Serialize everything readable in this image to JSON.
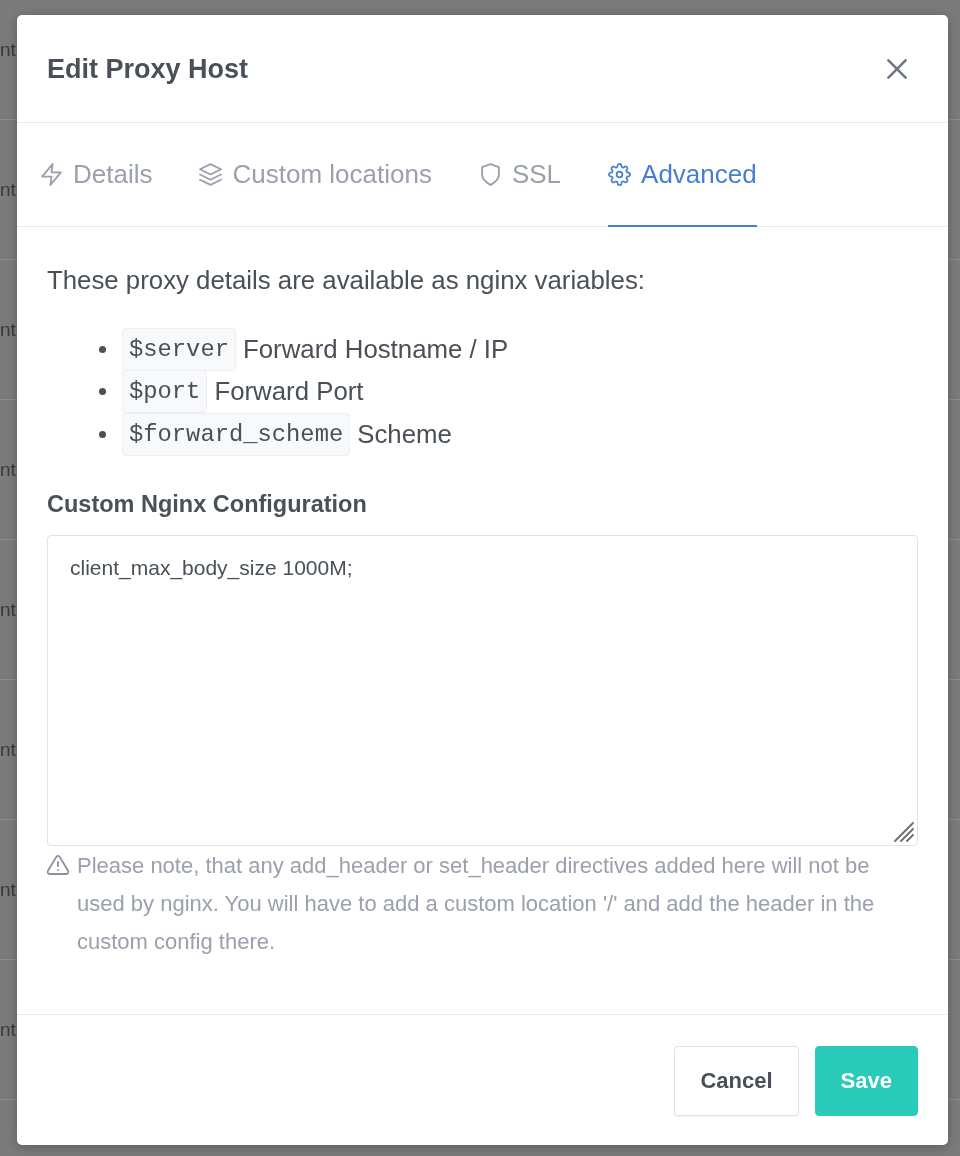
{
  "background_rows": [
    {
      "text": "nt"
    },
    {
      "text": "nt"
    },
    {
      "text": "nt"
    },
    {
      "text": "nt"
    },
    {
      "text": "nt"
    },
    {
      "text": "nt"
    },
    {
      "text": "nt"
    },
    {
      "text": "nt"
    }
  ],
  "dialog": {
    "title": "Edit Proxy Host"
  },
  "tabs": [
    {
      "label": "Details",
      "selected": false
    },
    {
      "label": "Custom locations",
      "selected": false
    },
    {
      "label": "SSL",
      "selected": false
    },
    {
      "label": "Advanced",
      "selected": true
    }
  ],
  "advanced": {
    "intro": "These proxy details are available as nginx variables:",
    "variables": [
      {
        "code": "$server",
        "description": "Forward Hostname / IP"
      },
      {
        "code": "$port",
        "description": "Forward Port"
      },
      {
        "code": "$forward_scheme",
        "description": "Scheme"
      }
    ],
    "config_label": "Custom Nginx Configuration",
    "config_value": "client_max_body_size 1000M;",
    "note": "Please note, that any add_header or set_header directives added here will not be used by nginx. You will have to add a custom location '/' and add the header in the custom config there."
  },
  "buttons": [
    {
      "label": "Cancel",
      "kind": "secondary"
    },
    {
      "label": "Save",
      "kind": "primary"
    }
  ]
}
